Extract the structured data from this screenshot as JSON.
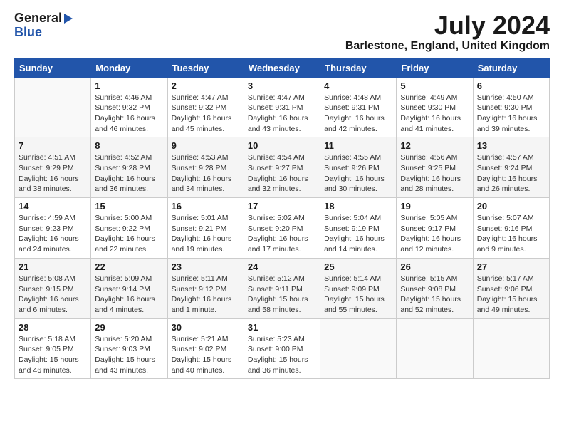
{
  "header": {
    "logo_general": "General",
    "logo_blue": "Blue",
    "title": "July 2024",
    "subtitle": "Barlestone, England, United Kingdom"
  },
  "calendar": {
    "days_of_week": [
      "Sunday",
      "Monday",
      "Tuesday",
      "Wednesday",
      "Thursday",
      "Friday",
      "Saturday"
    ],
    "weeks": [
      [
        {
          "day": "",
          "info": ""
        },
        {
          "day": "1",
          "info": "Sunrise: 4:46 AM\nSunset: 9:32 PM\nDaylight: 16 hours\nand 46 minutes."
        },
        {
          "day": "2",
          "info": "Sunrise: 4:47 AM\nSunset: 9:32 PM\nDaylight: 16 hours\nand 45 minutes."
        },
        {
          "day": "3",
          "info": "Sunrise: 4:47 AM\nSunset: 9:31 PM\nDaylight: 16 hours\nand 43 minutes."
        },
        {
          "day": "4",
          "info": "Sunrise: 4:48 AM\nSunset: 9:31 PM\nDaylight: 16 hours\nand 42 minutes."
        },
        {
          "day": "5",
          "info": "Sunrise: 4:49 AM\nSunset: 9:30 PM\nDaylight: 16 hours\nand 41 minutes."
        },
        {
          "day": "6",
          "info": "Sunrise: 4:50 AM\nSunset: 9:30 PM\nDaylight: 16 hours\nand 39 minutes."
        }
      ],
      [
        {
          "day": "7",
          "info": "Sunrise: 4:51 AM\nSunset: 9:29 PM\nDaylight: 16 hours\nand 38 minutes."
        },
        {
          "day": "8",
          "info": "Sunrise: 4:52 AM\nSunset: 9:28 PM\nDaylight: 16 hours\nand 36 minutes."
        },
        {
          "day": "9",
          "info": "Sunrise: 4:53 AM\nSunset: 9:28 PM\nDaylight: 16 hours\nand 34 minutes."
        },
        {
          "day": "10",
          "info": "Sunrise: 4:54 AM\nSunset: 9:27 PM\nDaylight: 16 hours\nand 32 minutes."
        },
        {
          "day": "11",
          "info": "Sunrise: 4:55 AM\nSunset: 9:26 PM\nDaylight: 16 hours\nand 30 minutes."
        },
        {
          "day": "12",
          "info": "Sunrise: 4:56 AM\nSunset: 9:25 PM\nDaylight: 16 hours\nand 28 minutes."
        },
        {
          "day": "13",
          "info": "Sunrise: 4:57 AM\nSunset: 9:24 PM\nDaylight: 16 hours\nand 26 minutes."
        }
      ],
      [
        {
          "day": "14",
          "info": "Sunrise: 4:59 AM\nSunset: 9:23 PM\nDaylight: 16 hours\nand 24 minutes."
        },
        {
          "day": "15",
          "info": "Sunrise: 5:00 AM\nSunset: 9:22 PM\nDaylight: 16 hours\nand 22 minutes."
        },
        {
          "day": "16",
          "info": "Sunrise: 5:01 AM\nSunset: 9:21 PM\nDaylight: 16 hours\nand 19 minutes."
        },
        {
          "day": "17",
          "info": "Sunrise: 5:02 AM\nSunset: 9:20 PM\nDaylight: 16 hours\nand 17 minutes."
        },
        {
          "day": "18",
          "info": "Sunrise: 5:04 AM\nSunset: 9:19 PM\nDaylight: 16 hours\nand 14 minutes."
        },
        {
          "day": "19",
          "info": "Sunrise: 5:05 AM\nSunset: 9:17 PM\nDaylight: 16 hours\nand 12 minutes."
        },
        {
          "day": "20",
          "info": "Sunrise: 5:07 AM\nSunset: 9:16 PM\nDaylight: 16 hours\nand 9 minutes."
        }
      ],
      [
        {
          "day": "21",
          "info": "Sunrise: 5:08 AM\nSunset: 9:15 PM\nDaylight: 16 hours\nand 6 minutes."
        },
        {
          "day": "22",
          "info": "Sunrise: 5:09 AM\nSunset: 9:14 PM\nDaylight: 16 hours\nand 4 minutes."
        },
        {
          "day": "23",
          "info": "Sunrise: 5:11 AM\nSunset: 9:12 PM\nDaylight: 16 hours\nand 1 minute."
        },
        {
          "day": "24",
          "info": "Sunrise: 5:12 AM\nSunset: 9:11 PM\nDaylight: 15 hours\nand 58 minutes."
        },
        {
          "day": "25",
          "info": "Sunrise: 5:14 AM\nSunset: 9:09 PM\nDaylight: 15 hours\nand 55 minutes."
        },
        {
          "day": "26",
          "info": "Sunrise: 5:15 AM\nSunset: 9:08 PM\nDaylight: 15 hours\nand 52 minutes."
        },
        {
          "day": "27",
          "info": "Sunrise: 5:17 AM\nSunset: 9:06 PM\nDaylight: 15 hours\nand 49 minutes."
        }
      ],
      [
        {
          "day": "28",
          "info": "Sunrise: 5:18 AM\nSunset: 9:05 PM\nDaylight: 15 hours\nand 46 minutes."
        },
        {
          "day": "29",
          "info": "Sunrise: 5:20 AM\nSunset: 9:03 PM\nDaylight: 15 hours\nand 43 minutes."
        },
        {
          "day": "30",
          "info": "Sunrise: 5:21 AM\nSunset: 9:02 PM\nDaylight: 15 hours\nand 40 minutes."
        },
        {
          "day": "31",
          "info": "Sunrise: 5:23 AM\nSunset: 9:00 PM\nDaylight: 15 hours\nand 36 minutes."
        },
        {
          "day": "",
          "info": ""
        },
        {
          "day": "",
          "info": ""
        },
        {
          "day": "",
          "info": ""
        }
      ]
    ]
  }
}
